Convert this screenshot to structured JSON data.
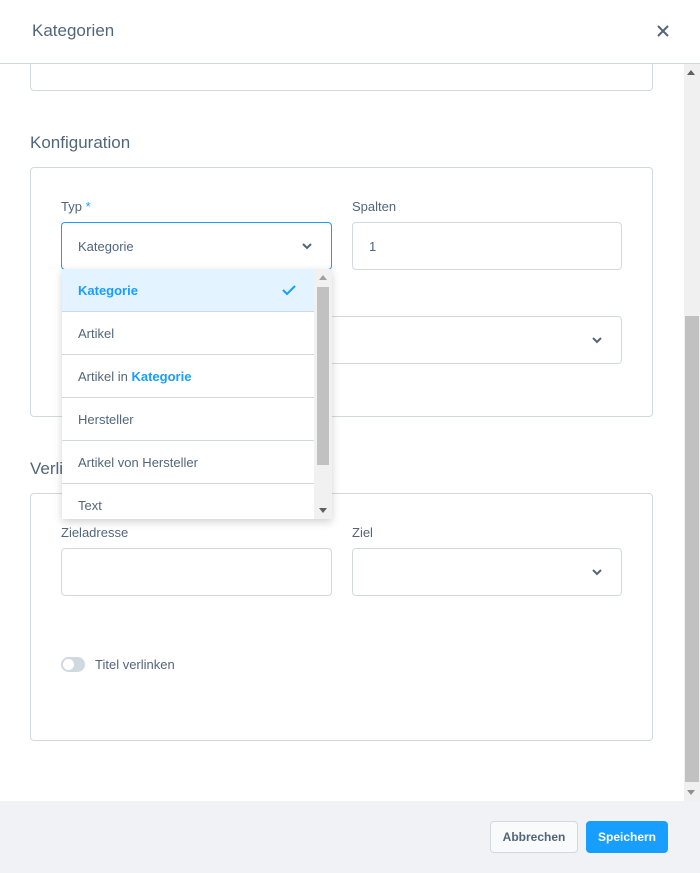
{
  "modal": {
    "title": "Kategorien",
    "close_icon": "close-icon"
  },
  "konfiguration": {
    "section_title": "Konfiguration",
    "typ": {
      "label": "Typ",
      "required_marker": "*",
      "value": "Kategorie"
    },
    "spalten": {
      "label": "Spalten",
      "value": "1"
    },
    "second_select": {
      "value": ""
    }
  },
  "dropdown": {
    "options": [
      {
        "label": "Kategorie",
        "selected": true
      },
      {
        "label": "Artikel",
        "selected": false
      },
      {
        "label": "Artikel in ",
        "highlight": "Kategorie",
        "selected": false
      },
      {
        "label": "Hersteller",
        "selected": false
      },
      {
        "label": "Artikel von Hersteller",
        "selected": false
      },
      {
        "label": "Text",
        "selected": false
      }
    ]
  },
  "verlinkung": {
    "section_title_partial": "Verli",
    "zieladresse": {
      "label": "Zieladresse",
      "value": ""
    },
    "ziel": {
      "label": "Ziel",
      "value": ""
    },
    "titel_verlinken": {
      "label": "Titel verlinken",
      "enabled": false
    }
  },
  "footer": {
    "cancel_label": "Abbrechen",
    "save_label": "Speichern"
  },
  "colors": {
    "accent": "#189eff",
    "text": "#52667a",
    "border": "#d1d9e0",
    "selected_bg": "#e3f3ff",
    "footer_bg": "#f0f2f5"
  }
}
